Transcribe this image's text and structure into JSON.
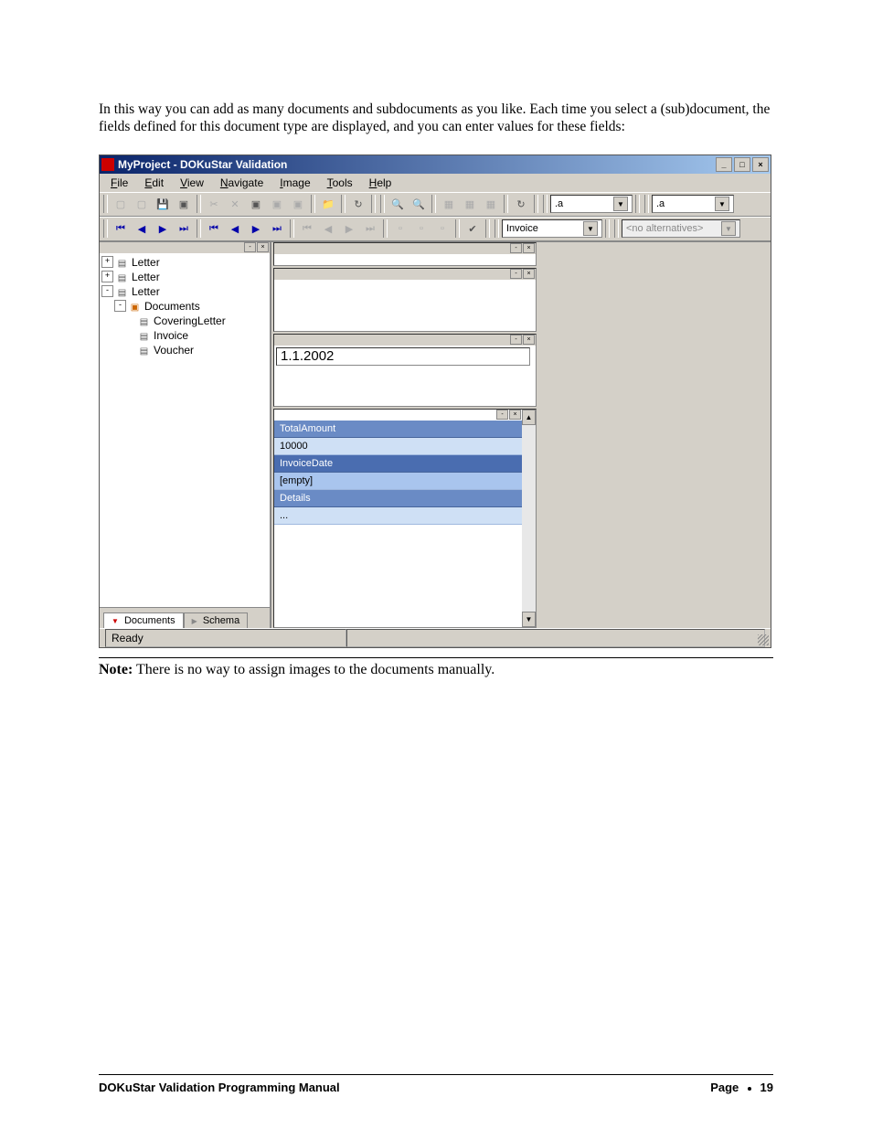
{
  "intro": "In this way you can add as many documents and subdocuments as you like. Each time you select a (sub)document, the fields defined for this document type are displayed, and you can enter values for these fields:",
  "app": {
    "title": "MyProject - DOKuStar Validation"
  },
  "menu": {
    "file": "File",
    "edit": "Edit",
    "view": "View",
    "navigate": "Navigate",
    "image": "Image",
    "tools": "Tools",
    "help": "Help"
  },
  "toolbar2": {
    "combo1": "Invoice",
    "combo2": "<no alternatives>"
  },
  "combo_a": ".a",
  "combo_b": ".a",
  "tree": {
    "items": [
      {
        "label": "Letter",
        "indent": 0,
        "exp": "+",
        "icon": "doc"
      },
      {
        "label": "Letter",
        "indent": 0,
        "exp": "+",
        "icon": "doc"
      },
      {
        "label": "Letter",
        "indent": 0,
        "exp": "-",
        "icon": "doc"
      },
      {
        "label": "Documents",
        "indent": 1,
        "exp": "-",
        "icon": "folder"
      },
      {
        "label": "CoveringLetter",
        "indent": 2,
        "exp": "",
        "icon": "doc"
      },
      {
        "label": "Invoice",
        "indent": 2,
        "exp": "",
        "icon": "doc"
      },
      {
        "label": "Voucher",
        "indent": 2,
        "exp": "",
        "icon": "doc"
      }
    ]
  },
  "tabs": {
    "documents": "Documents",
    "schema": "Schema"
  },
  "field_value": "1.1.2002",
  "fields": {
    "totalamount_label": "TotalAmount",
    "totalamount_value": "10000",
    "invoicedate_label": "InvoiceDate",
    "invoicedate_value": "[empty]",
    "details_label": "Details",
    "details_value": "..."
  },
  "status": "Ready",
  "note_label": "Note:",
  "note_text": " There is no way to assign images to the documents manually.",
  "footer": {
    "left": "DOKuStar Validation Programming Manual",
    "page_label": "Page",
    "page_num": "19"
  }
}
